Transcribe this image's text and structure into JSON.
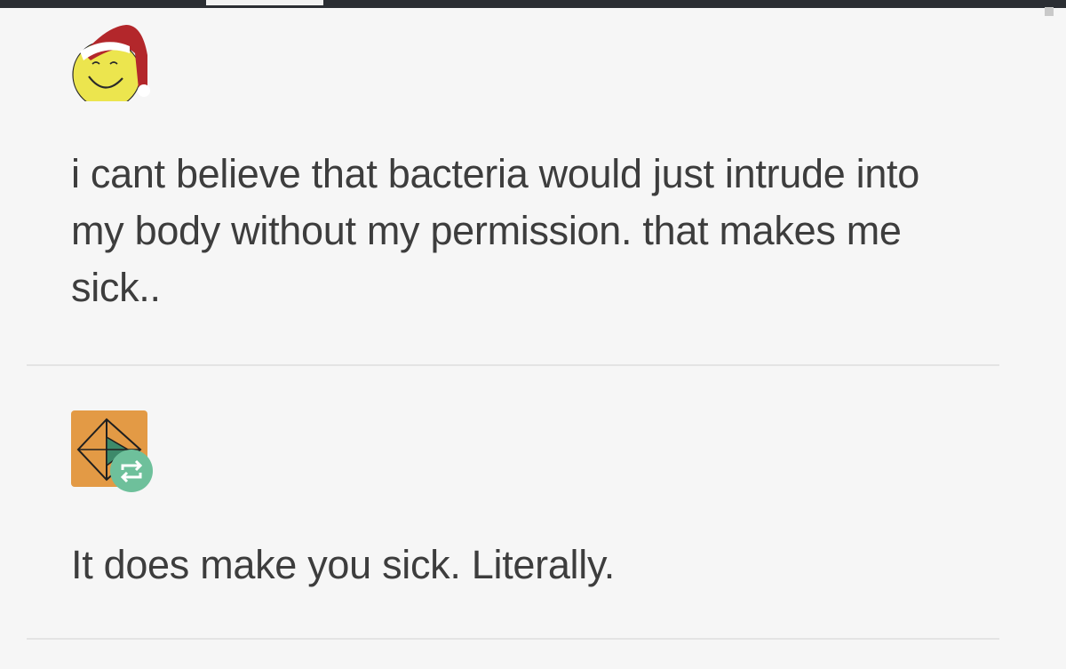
{
  "posts": [
    {
      "avatar_icon": "smiley-santa-hat-icon",
      "text": "i cant believe that bacteria would just intrude into my body without my permission. that makes me sick.."
    },
    {
      "avatar_icon": "orange-geometric-avatar-icon",
      "badge_icon": "reblog-icon",
      "text": "It does make you sick. Literally."
    }
  ],
  "colors": {
    "background": "#f6f6f6",
    "text": "#3d3d3d",
    "divider": "#e4e4e4",
    "reblog_badge": "#6ec09b",
    "avatar_orange": "#e39a45",
    "smiley_yellow": "#ece54e",
    "santa_red": "#b3272b"
  }
}
